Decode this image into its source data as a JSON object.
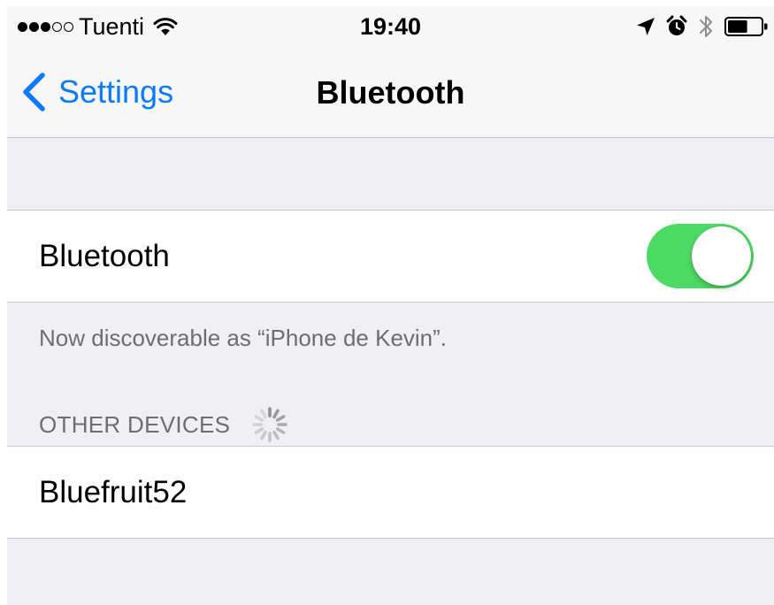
{
  "status_bar": {
    "signal": {
      "filled": 3,
      "total": 5
    },
    "carrier": "Tuenti",
    "time": "19:40",
    "icons": [
      "wifi-icon",
      "location-icon",
      "alarm-icon",
      "bluetooth-icon",
      "battery-icon"
    ],
    "battery_level": 0.6
  },
  "nav": {
    "back_label": "Settings",
    "title": "Bluetooth"
  },
  "bluetooth_cell": {
    "label": "Bluetooth",
    "toggle_on": true
  },
  "footer": "Now discoverable as “iPhone de Kevin”.",
  "other_devices": {
    "header": "OTHER DEVICES",
    "items": [
      {
        "label": "Bluefruit52"
      }
    ]
  },
  "colors": {
    "accent": "#0a7aff",
    "toggle_on": "#4cd964",
    "background": "#efeff4",
    "secondary_text": "#6d6d72"
  }
}
